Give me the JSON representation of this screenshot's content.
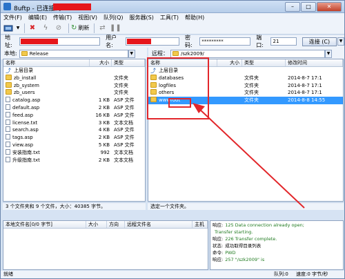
{
  "window": {
    "title": "8uftp - 已连接到",
    "controls": [
      "–",
      "□",
      "✕"
    ]
  },
  "menu": [
    "文件(F)",
    "编辑(E)",
    "传输(T)",
    "视图(V)",
    "队列(Q)",
    "服务器(S)",
    "工具(T)",
    "帮助(H)"
  ],
  "toolbar": {
    "refresh_label": "刷新"
  },
  "connection": {
    "host_label": "地址:",
    "user_label": "用户名:",
    "password_label": "密码:",
    "password_value": "*********",
    "port_label": "端口:",
    "port_value": "21",
    "connect_label": "连接 (C)"
  },
  "local": {
    "label": "本地:",
    "path": "Release",
    "columns": [
      "名称",
      "大小",
      "类型"
    ],
    "rows": [
      {
        "name": "上层目录",
        "size": "",
        "type": "",
        "icon": "up-icon"
      },
      {
        "name": "zb_install",
        "size": "",
        "type": "文件夹",
        "icon": "folder-icon"
      },
      {
        "name": "zb_system",
        "size": "",
        "type": "文件夹",
        "icon": "folder-icon"
      },
      {
        "name": "zb_users",
        "size": "",
        "type": "文件夹",
        "icon": "folder-icon"
      },
      {
        "name": "catalog.asp",
        "size": "1 KB",
        "type": "ASP 文件",
        "icon": "file-icon"
      },
      {
        "name": "default.asp",
        "size": "2 KB",
        "type": "ASP 文件",
        "icon": "file-icon"
      },
      {
        "name": "feed.asp",
        "size": "16 KB",
        "type": "ASP 文件",
        "icon": "file-icon"
      },
      {
        "name": "license.txt",
        "size": "3 KB",
        "type": "文本文档",
        "icon": "file-icon"
      },
      {
        "name": "search.asp",
        "size": "4 KB",
        "type": "ASP 文件",
        "icon": "file-icon"
      },
      {
        "name": "tags.asp",
        "size": "2 KB",
        "type": "ASP 文件",
        "icon": "file-icon"
      },
      {
        "name": "view.asp",
        "size": "5 KB",
        "type": "ASP 文件",
        "icon": "file-icon"
      },
      {
        "name": "安装指南.txt",
        "size": "992",
        "type": "文本文档",
        "icon": "file-icon"
      },
      {
        "name": "升级指南.txt",
        "size": "2 KB",
        "type": "文本文档",
        "icon": "file-icon"
      }
    ],
    "status": "3 个文件夹和 9 个文件，大小：40385 字节。"
  },
  "remote": {
    "label": "远程：",
    "path": "/szk2009/",
    "columns": [
      "名称",
      "大小",
      "类型",
      "修改时间"
    ],
    "rows": [
      {
        "name": "上层目录",
        "size": "",
        "type": "",
        "modified": "",
        "icon": "up-icon",
        "selected": false
      },
      {
        "name": "databases",
        "size": "",
        "type": "文件夹",
        "modified": "2014-8-7 17:1",
        "icon": "folder-icon",
        "selected": false
      },
      {
        "name": "logfiles",
        "size": "",
        "type": "文件夹",
        "modified": "2014-8-7 17:1",
        "icon": "folder-icon",
        "selected": false
      },
      {
        "name": "others",
        "size": "",
        "type": "文件夹",
        "modified": "2014-8-7 17:1",
        "icon": "folder-icon",
        "selected": false
      },
      {
        "name": "wwwroot",
        "size": "",
        "type": "文件夹",
        "modified": "2014-8-8 14:55",
        "icon": "folder-icon",
        "selected": true
      }
    ],
    "status": "选定一个文件夹。"
  },
  "queue": {
    "columns": [
      "本地文件名[0/0 字节]",
      "大小",
      "方向",
      "远程文件名",
      "主机"
    ]
  },
  "log": [
    {
      "k": "响应:",
      "v": "125 Data connection already open;"
    },
    {
      "k": "",
      "v": "Transfer starting."
    },
    {
      "k": "响应:",
      "v": "226 Transfer complete."
    },
    {
      "k": "状态:",
      "v": "成功取得目录列表"
    },
    {
      "k": "命令:",
      "v": "PWD"
    },
    {
      "k": "响应:",
      "v": "257 \"/szk2009\" is"
    }
  ],
  "statusbar": {
    "ready": "就绪",
    "mode": "队列:0",
    "speed": "速度:0 字节/秒"
  },
  "colors": {
    "annotation": "#e2262a",
    "selection": "#3399ff",
    "redaction": "#e6161b"
  }
}
